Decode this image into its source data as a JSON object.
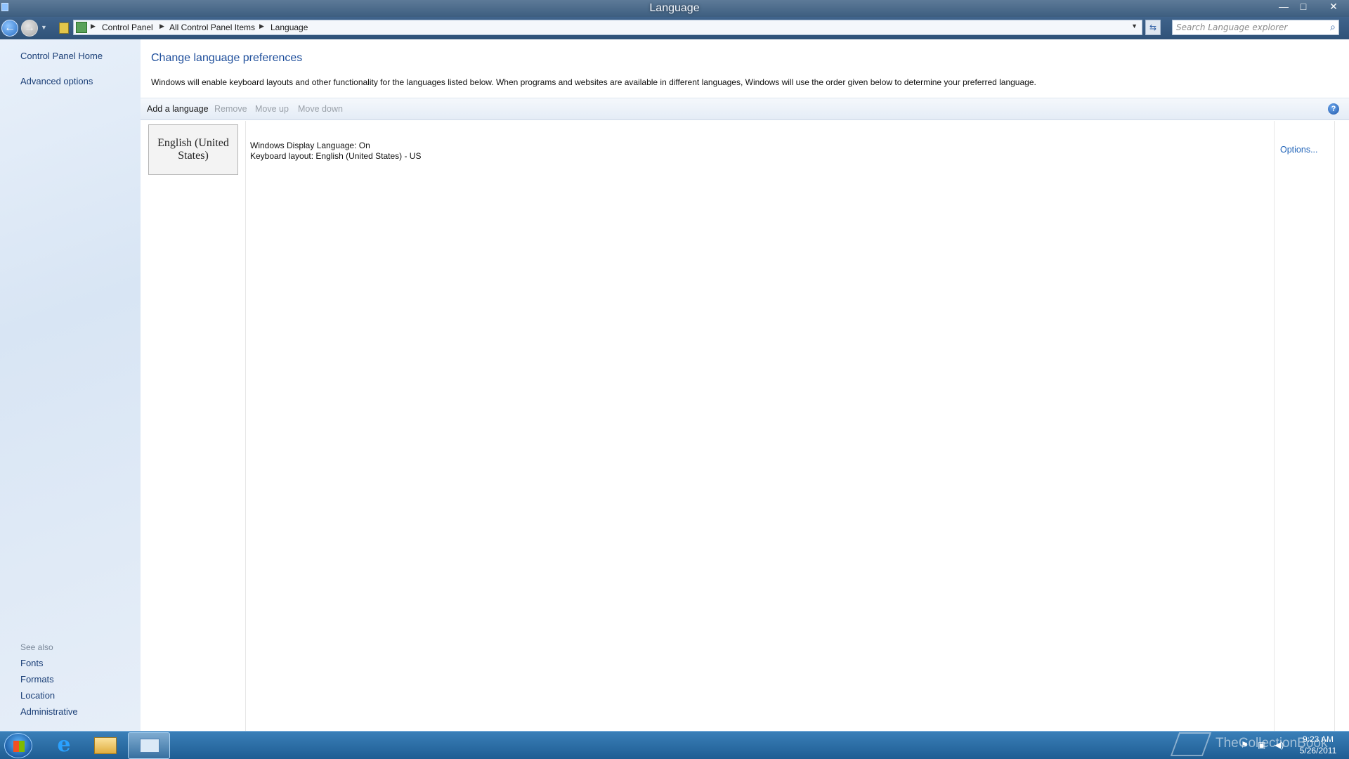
{
  "window": {
    "title": "Language"
  },
  "navigation": {
    "breadcrumbs": [
      "Control Panel",
      "All Control Panel Items",
      "Language"
    ],
    "search_placeholder": "Search Language explorer"
  },
  "left_pane": {
    "links": [
      "Control Panel Home",
      "Advanced options"
    ],
    "see_also_label": "See also",
    "see_also_links": [
      "Fonts",
      "Formats",
      "Location",
      "Administrative"
    ]
  },
  "main": {
    "heading": "Change language preferences",
    "description": "Windows will enable keyboard layouts and other functionality for the languages listed below. When programs and websites are available in different languages, Windows will use the order given below to determine your preferred language.",
    "toolbar": {
      "add": "Add a language",
      "remove": "Remove",
      "move_up": "Move up",
      "move_down": "Move down"
    },
    "languages": [
      {
        "name_line1": "English (United",
        "name_line2": "States)",
        "display_language": "Windows Display Language: On",
        "keyboard_layout": "Keyboard layout: English (United States) - US",
        "options_label": "Options..."
      }
    ]
  },
  "taskbar": {
    "watermark": "TheCollectionBook",
    "time": "9:23 AM",
    "date": "5/26/2011"
  },
  "icons": {
    "help": "?",
    "ie": "e"
  },
  "colors": {
    "heading": "#1e4e9b",
    "link": "#1e62b8",
    "disabled": "#9aa1a9",
    "left_pane_link": "#1b3f77"
  }
}
